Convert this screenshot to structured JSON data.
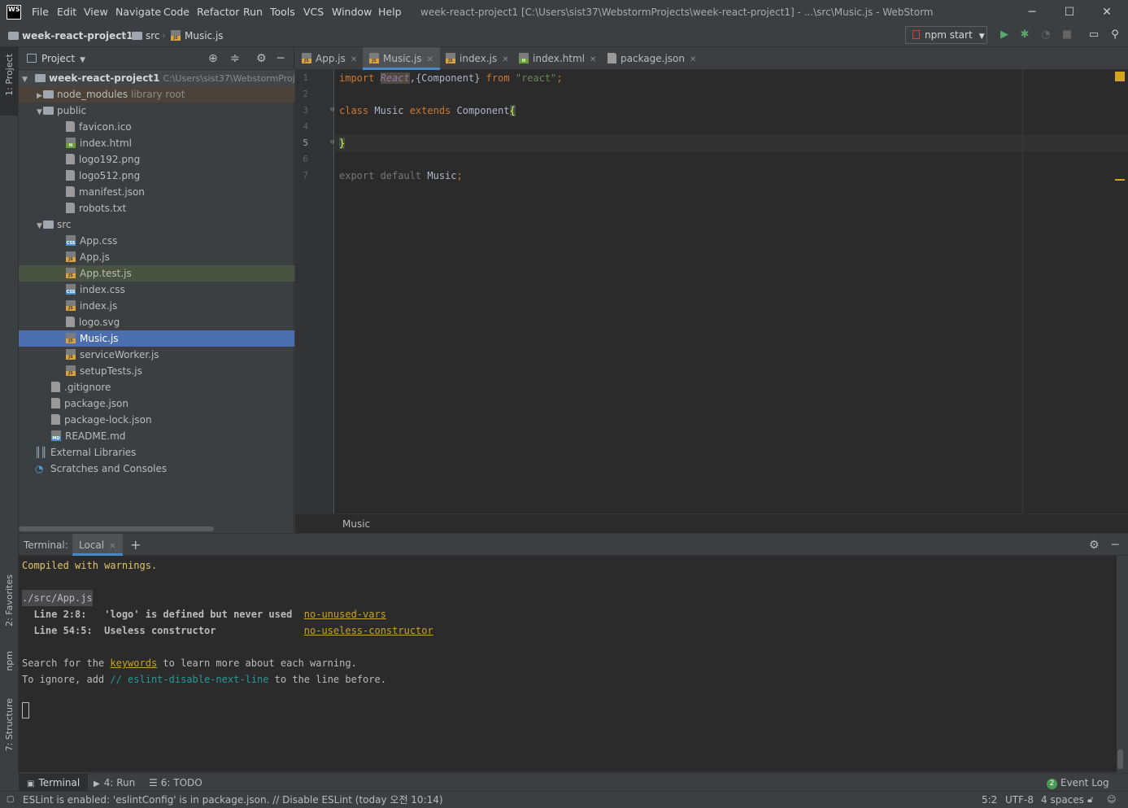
{
  "menu": [
    "File",
    "Edit",
    "View",
    "Navigate",
    "Code",
    "Refactor",
    "Run",
    "Tools",
    "VCS",
    "Window",
    "Help"
  ],
  "logo_text": "WS",
  "window_title": "week-react-project1 [C:\\Users\\sist37\\WebstormProjects\\week-react-project1] - ...\\src\\Music.js - WebStorm",
  "breadcrumb": {
    "project": "week-react-project1",
    "folder": "src",
    "file": "Music.js"
  },
  "run_config": "npm start",
  "project_panel": {
    "title": "Project",
    "root_name": "week-react-project1",
    "root_path": "C:\\Users\\sist37\\WebstormProj",
    "node_modules": "node_modules",
    "node_modules_hint": "library root",
    "public": "public",
    "public_files": [
      "favicon.ico",
      "index.html",
      "logo192.png",
      "logo512.png",
      "manifest.json",
      "robots.txt"
    ],
    "src": "src",
    "src_files": [
      "App.css",
      "App.js",
      "App.test.js",
      "index.css",
      "index.js",
      "logo.svg",
      "Music.js",
      "serviceWorker.js",
      "setupTests.js"
    ],
    "root_files": [
      ".gitignore",
      "package.json",
      "package-lock.json",
      "README.md"
    ],
    "external": "External Libraries",
    "scratches": "Scratches and Consoles"
  },
  "left_tabs": {
    "project": "1: Project",
    "favorites": "2: Favorites",
    "npm": "npm",
    "structure": "7: Structure"
  },
  "tabs": [
    "App.js",
    "Music.js",
    "index.js",
    "index.html",
    "package.json"
  ],
  "active_tab": "Music.js",
  "editor": {
    "line_numbers": [
      "1",
      "2",
      "3",
      "4",
      "5",
      "6",
      "7"
    ],
    "line1": {
      "kw": "import",
      "react": "React",
      "rest": ",{Component} ",
      "from": "from",
      "str": "\"react\"",
      "semi": ";"
    },
    "line3": {
      "kw1": "class",
      "name": " Music ",
      "kw2": "extends",
      "rest": " Component",
      "brace": "{"
    },
    "line5": "}",
    "line7": {
      "dim": "export default ",
      "name": "Music",
      "semi": ";"
    },
    "breadcrumb": "Music"
  },
  "terminal": {
    "label": "Terminal:",
    "tab": "Local",
    "line1": "Compiled with warnings.",
    "file": "./src/App.js",
    "warn1_text": "  Line 2:8:   'logo' is defined but never used  ",
    "warn1_rule": "no-unused-vars",
    "warn2_text": "  Line 54:5:  Useless constructor               ",
    "warn2_rule": "no-useless-constructor",
    "search_pre": "Search for the ",
    "search_kw": "keywords",
    "search_post": " to learn more about each warning.",
    "ignore_pre": "To ignore, add ",
    "ignore_code": "// eslint-disable-next-line",
    "ignore_post": " to the line before."
  },
  "tool_windows": {
    "terminal": "Terminal",
    "run": "4: Run",
    "todo": "6: TODO",
    "event_log": "Event Log",
    "event_count": "2"
  },
  "status": {
    "message": "ESLint is enabled: 'eslintConfig' is in package.json. // Disable ESLint (today 오전 10:14)",
    "position": "5:2",
    "encoding": "UTF-8",
    "indent": "4 spaces"
  }
}
